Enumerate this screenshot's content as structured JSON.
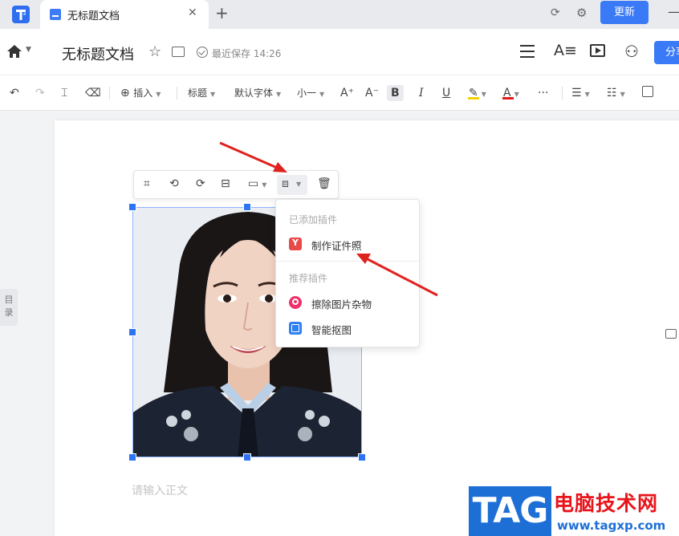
{
  "titlebar": {
    "tab_title": "无标题文档",
    "update_label": "更新"
  },
  "header": {
    "doc_title": "无标题文档",
    "save_status": "最近保存 14:26",
    "share_label": "分享"
  },
  "toolbar": {
    "insert_label": "插入",
    "heading_label": "标题",
    "font_label": "默认字体",
    "size_label": "小一",
    "bold_label": "B",
    "italic_label": "I",
    "underline_label": "U",
    "font_color_label": "A",
    "more_label": "···"
  },
  "sidebar": {
    "directory_label": "目录"
  },
  "editor": {
    "placeholder": "请输入正文"
  },
  "plugin_menu": {
    "added_section": "已添加插件",
    "added_items": [
      {
        "label": "制作证件照",
        "icon": "id-photo-icon",
        "color": "#e84a4a"
      }
    ],
    "recommended_section": "推荐插件",
    "recommended_items": [
      {
        "label": "擦除图片杂物",
        "icon": "eraser-plugin-icon",
        "color": "#f0306a"
      },
      {
        "label": "智能抠图",
        "icon": "cutout-plugin-icon",
        "color": "#2f80f0"
      }
    ]
  },
  "watermark": {
    "logo_text": "TAG",
    "site_name": "电脑技术网",
    "url": "www.tagxp.com"
  },
  "colors": {
    "accent": "#3a7af6",
    "annotation_arrow": "#e0221f"
  }
}
